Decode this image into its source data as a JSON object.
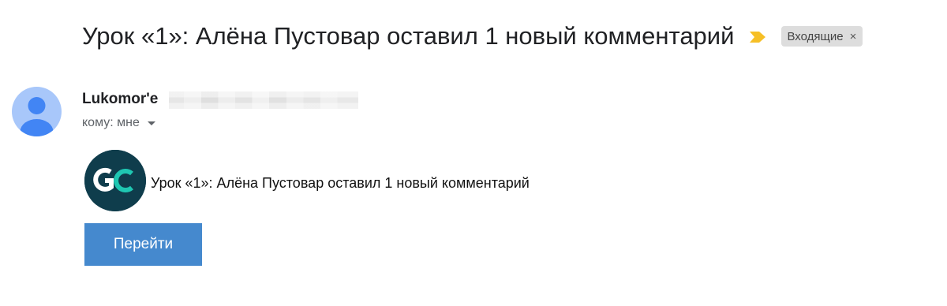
{
  "email": {
    "subject": "Урок «1»: Алёна Пустовар оставил 1 новый комментарий",
    "label": {
      "name": "Входящие",
      "remove_symbol": "×"
    },
    "importance_marker_color": "#f6bf26"
  },
  "sender": {
    "name": "Lukomor'e",
    "recipient_text": "кому: мне",
    "avatar_background": "#a8c7fa",
    "avatar_figure": "#4285f4"
  },
  "body": {
    "logo": {
      "letters_left": "G",
      "letters_right": "C",
      "background": "#0f3d4c",
      "accent": "#1fc7b2"
    },
    "message": "Урок «1»: Алёна Пустовар оставил 1 новый комментарий",
    "button_label": "Перейти",
    "button_color": "#4589ce"
  }
}
